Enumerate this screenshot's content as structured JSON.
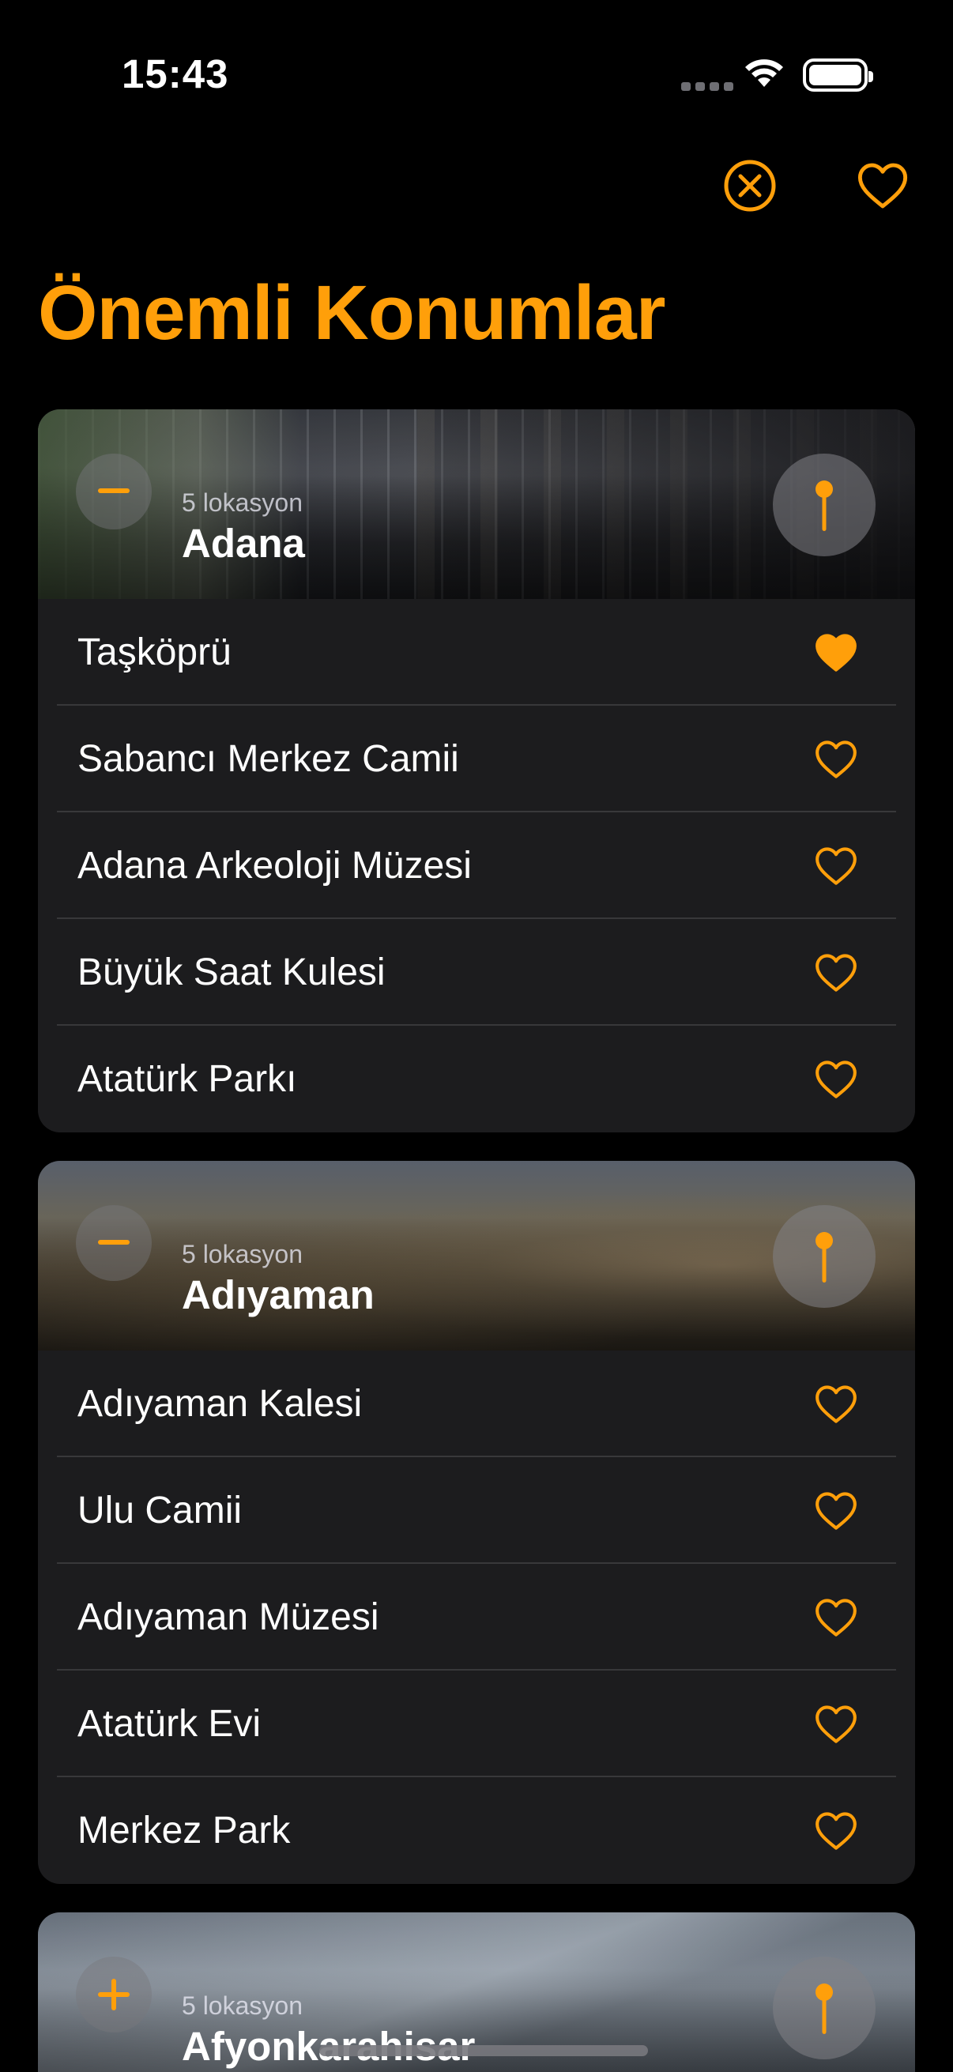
{
  "status_bar": {
    "time": "15:43"
  },
  "nav": {
    "close_icon": "xmark-circle-icon",
    "favorites_icon": "heart-icon"
  },
  "title": "Önemli Konumlar",
  "colors": {
    "accent": "#ff9f0a",
    "background": "#000000",
    "card": "#1c1c1e",
    "separator": "#38383a"
  },
  "cities": [
    {
      "name": "Adana",
      "count": "5 lokasyon",
      "expanded": true,
      "locations": [
        {
          "name": "Taşköprü",
          "favorite": true
        },
        {
          "name": "Sabancı Merkez Camii",
          "favorite": false
        },
        {
          "name": "Adana Arkeoloji Müzesi",
          "favorite": false
        },
        {
          "name": "Büyük Saat Kulesi",
          "favorite": false
        },
        {
          "name": "Atatürk Parkı",
          "favorite": false
        }
      ]
    },
    {
      "name": "Adıyaman",
      "count": "5 lokasyon",
      "expanded": true,
      "locations": [
        {
          "name": "Adıyaman Kalesi",
          "favorite": false
        },
        {
          "name": "Ulu Camii",
          "favorite": false
        },
        {
          "name": "Adıyaman Müzesi",
          "favorite": false
        },
        {
          "name": "Atatürk Evi",
          "favorite": false
        },
        {
          "name": "Merkez Park",
          "favorite": false
        }
      ]
    },
    {
      "name": "Afyonkarahisar",
      "count": "5 lokasyon",
      "expanded": false,
      "locations": []
    }
  ]
}
